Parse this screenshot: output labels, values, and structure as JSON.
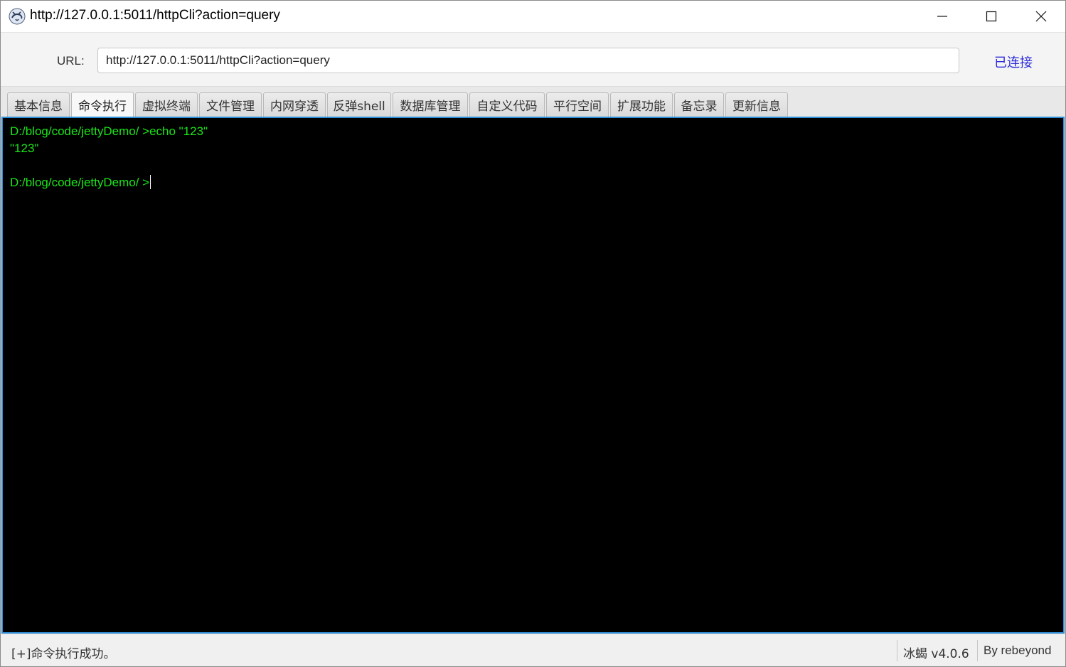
{
  "window": {
    "title": "http://127.0.0.1:5011/httpCli?action=query",
    "controls": [
      "minimize-icon",
      "maximize-icon",
      "close-icon"
    ]
  },
  "urlbar": {
    "label": "URL:",
    "value": "http://127.0.0.1:5011/httpCli?action=query",
    "status": "已连接",
    "status_color": "#2b2bd9"
  },
  "tabs": [
    {
      "label": "基本信息"
    },
    {
      "label": "命令执行",
      "active": true
    },
    {
      "label": "虚拟终端"
    },
    {
      "label": "文件管理"
    },
    {
      "label": "内网穿透"
    },
    {
      "label": "反弹shell"
    },
    {
      "label": "数据库管理"
    },
    {
      "label": "自定义代码"
    },
    {
      "label": "平行空间"
    },
    {
      "label": "扩展功能"
    },
    {
      "label": "备忘录"
    },
    {
      "label": "更新信息"
    }
  ],
  "terminal": {
    "lines": [
      "D:/blog/code/jettyDemo/ >echo \"123\"",
      "\"123\"",
      "",
      "D:/blog/code/jettyDemo/ >"
    ],
    "text_color": "#19e619",
    "background": "#000000",
    "border_color": "#2f8dd6"
  },
  "statusbar": {
    "message": "[+]命令执行成功。",
    "version": "冰蝎 v4.0.6",
    "author": "By rebeyond"
  }
}
